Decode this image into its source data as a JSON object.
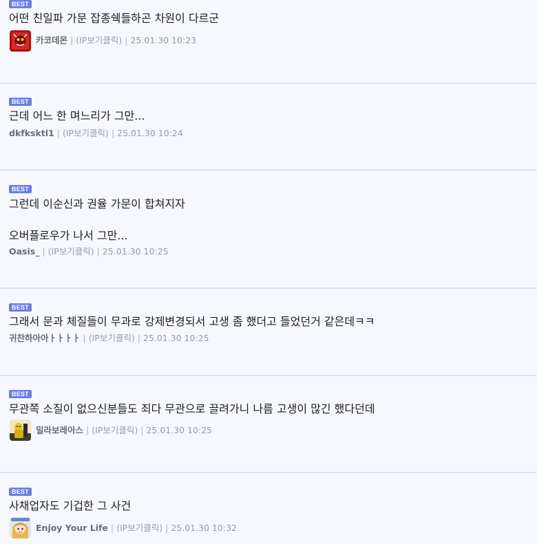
{
  "badge": "BEST",
  "comments": [
    {
      "lines": [
        "어떤 친일파 가문 잡종쉑들하곤 차원이 다르군"
      ],
      "nick": "카코데몬",
      "ip": "(IP보기클릭)",
      "time": "25.01.30 10:23",
      "avatar": "red-demon-avatar"
    },
    {
      "lines": [
        "근데 어느 한 며느리가 그만..."
      ],
      "nick": "dkfksktl1",
      "ip": "(IP보기클릭)",
      "time": "25.01.30 10:24",
      "avatar": ""
    },
    {
      "lines": [
        "그런데 이순신과 권율 가문이 합쳐지자",
        "오버플로우가 나서 그만..."
      ],
      "nick": "Oasis_",
      "ip": "(IP보기클릭)",
      "time": "25.01.30 10:25",
      "avatar": ""
    },
    {
      "lines": [
        "그래서 문과 체질들이 무과로 강제변경되서 고생 좀 했더고 들었던거 같은데ㅋㅋ"
      ],
      "nick": "귀찬하아아ㅏㅏㅏㅏ",
      "ip": "(IP보기클릭)",
      "time": "25.01.30 10:25",
      "avatar": ""
    },
    {
      "lines": [
        "무관쪽 소질이 없으신분들도 죄다 무관으로 끌려가니 나름 고생이 많긴 했다던데"
      ],
      "nick": "밀라보레아스",
      "ip": "(IP보기클릭)",
      "time": "25.01.30 10:25",
      "avatar": "yellow-figure-avatar"
    },
    {
      "lines": [
        "사채업자도 기겁한 그 사건"
      ],
      "nick": "Enjoy Your Life",
      "ip": "(IP보기클릭)",
      "time": "25.01.30 10:32",
      "avatar": "anime-character-avatar"
    }
  ]
}
